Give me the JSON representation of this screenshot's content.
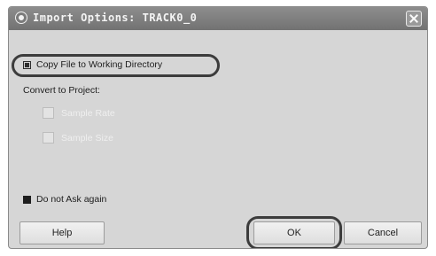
{
  "window": {
    "title": "Import Options: TRACK0_0",
    "title_icon": "app-icon",
    "close_icon": "close-icon"
  },
  "options": {
    "copy_file_label": "Copy File to Working Directory",
    "convert_label": "Convert to Project:",
    "sub_option_1_label": "Sample Rate",
    "sub_option_2_label": "Sample Size",
    "do_not_ask_label": "Do not Ask again"
  },
  "buttons": {
    "help": "Help",
    "ok": "OK",
    "cancel": "Cancel"
  },
  "colors": {
    "titlebar": "#808080",
    "dialog_bg": "#d6d6d6",
    "highlight_ring": "#3c3c3c"
  }
}
